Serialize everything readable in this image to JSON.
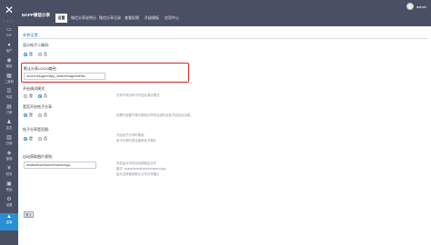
{
  "app": {
    "brand": "MAPP微信分享",
    "username": "admin"
  },
  "nav": {
    "tabs": [
      {
        "label": "设置",
        "active": true
      },
      {
        "label": "微信分享说明分",
        "active": false
      },
      {
        "label": "微信分享记录",
        "active": false
      },
      {
        "label": "查看权限",
        "active": false
      },
      {
        "label": "升级模板",
        "active": false
      },
      {
        "label": "应用中心",
        "active": false
      }
    ]
  },
  "sidebar": {
    "items": [
      {
        "icon": "monitor-icon",
        "label": "DIY"
      },
      {
        "icon": "user-icon",
        "label": "用户"
      },
      {
        "icon": "wechat-icon",
        "label": "微信"
      },
      {
        "icon": "qrcode-icon",
        "label": "二维码"
      },
      {
        "icon": "list-icon",
        "label": "内容"
      },
      {
        "icon": "order-icon",
        "label": "订单"
      },
      {
        "icon": "member-icon",
        "label": "会员"
      },
      {
        "icon": "chart-icon",
        "label": "分销"
      },
      {
        "icon": "sales-icon",
        "label": "营销"
      },
      {
        "icon": "finance-icon",
        "label": "财务"
      },
      {
        "icon": "goods-icon",
        "label": "商品"
      },
      {
        "icon": "setting-icon",
        "label": "设置"
      },
      {
        "icon": "app-icon",
        "label": "应用",
        "active": true
      }
    ]
  },
  "form": {
    "section_title": "参数设置",
    "qrcode_label": "显示帖子二维码:",
    "qrcode_options": [
      "是",
      "否"
    ],
    "qrcode_selected": "是",
    "logo_label": "默认分享LOGO路径:",
    "logo_value": "source/plugin/mapp_share/images/defau",
    "debug_label": "开启调试模式:",
    "debug_options": [
      "是",
      "否"
    ],
    "debug_selected": "否",
    "debug_help": "分享不成功时可开启此调试模式",
    "forum_share_label": "是否开启帖子分享:",
    "forum_share_options": [
      "是",
      "否"
    ],
    "forum_share_selected": "是",
    "forum_share_help": "如果开启额外提示图将分享的话请在此处开启论坛功能，",
    "forum_img_label": "帖子分享是否图:",
    "forum_img_options": [
      "是",
      "否"
    ],
    "forum_img_selected": "是",
    "forum_img_help_1": "开启帖子分享时使用",
    "forum_img_help_2": "帖子分享时是否使用帖子图片",
    "avatar_label": "自动获取图片规则:",
    "avatar_value": "avatar/team/baseth/name/logo",
    "avatar_help_1": "开启后分享将自动获取此文件",
    "avatar_help_2": "格式: avatar/team/baseth/name/logo",
    "avatar_help_3": "如无法请使用默认分享分享图片",
    "submit_label": "提交"
  },
  "colors": {
    "chrome": "#4a5064",
    "accent": "#2a8fd3",
    "highlight": "#d9231f"
  }
}
